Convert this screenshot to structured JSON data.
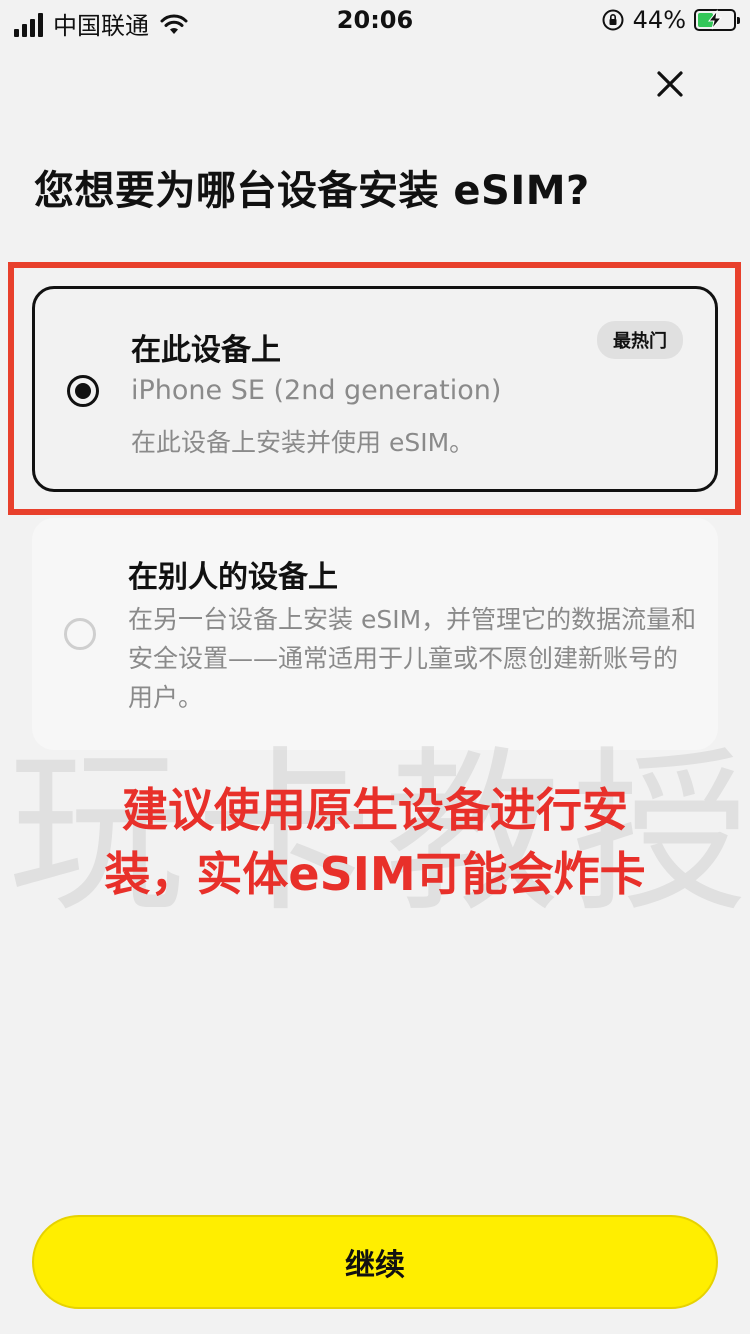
{
  "status_bar": {
    "carrier": "中国联通",
    "time": "20:06",
    "battery_percent": "44%",
    "battery_level": 0.44,
    "icons": [
      "signal-icon",
      "wifi-icon",
      "orientation-lock-icon",
      "battery-charging-icon"
    ]
  },
  "header": {
    "close_icon": "close-icon",
    "title": "您想要为哪台设备安装 eSIM?"
  },
  "options": [
    {
      "title": "在此设备上",
      "device": "iPhone SE (2nd generation)",
      "description": "在此设备上安装并使用 eSIM。",
      "badge": "最热门",
      "selected": true
    },
    {
      "title": "在别人的设备上",
      "description": "在另一台设备上安装 eSIM，并管理它的数据流量和安全设置——通常适用于儿童或不愿创建新账号的用户。",
      "selected": false
    }
  ],
  "watermark": "玩卡教授",
  "annotation": {
    "line1": "建议使用原生设备进行安",
    "line2": "装，实体eSIM可能会炸卡",
    "color": "#e8302a"
  },
  "footer": {
    "continue_label": "继续",
    "button_color": "#ffee00"
  }
}
